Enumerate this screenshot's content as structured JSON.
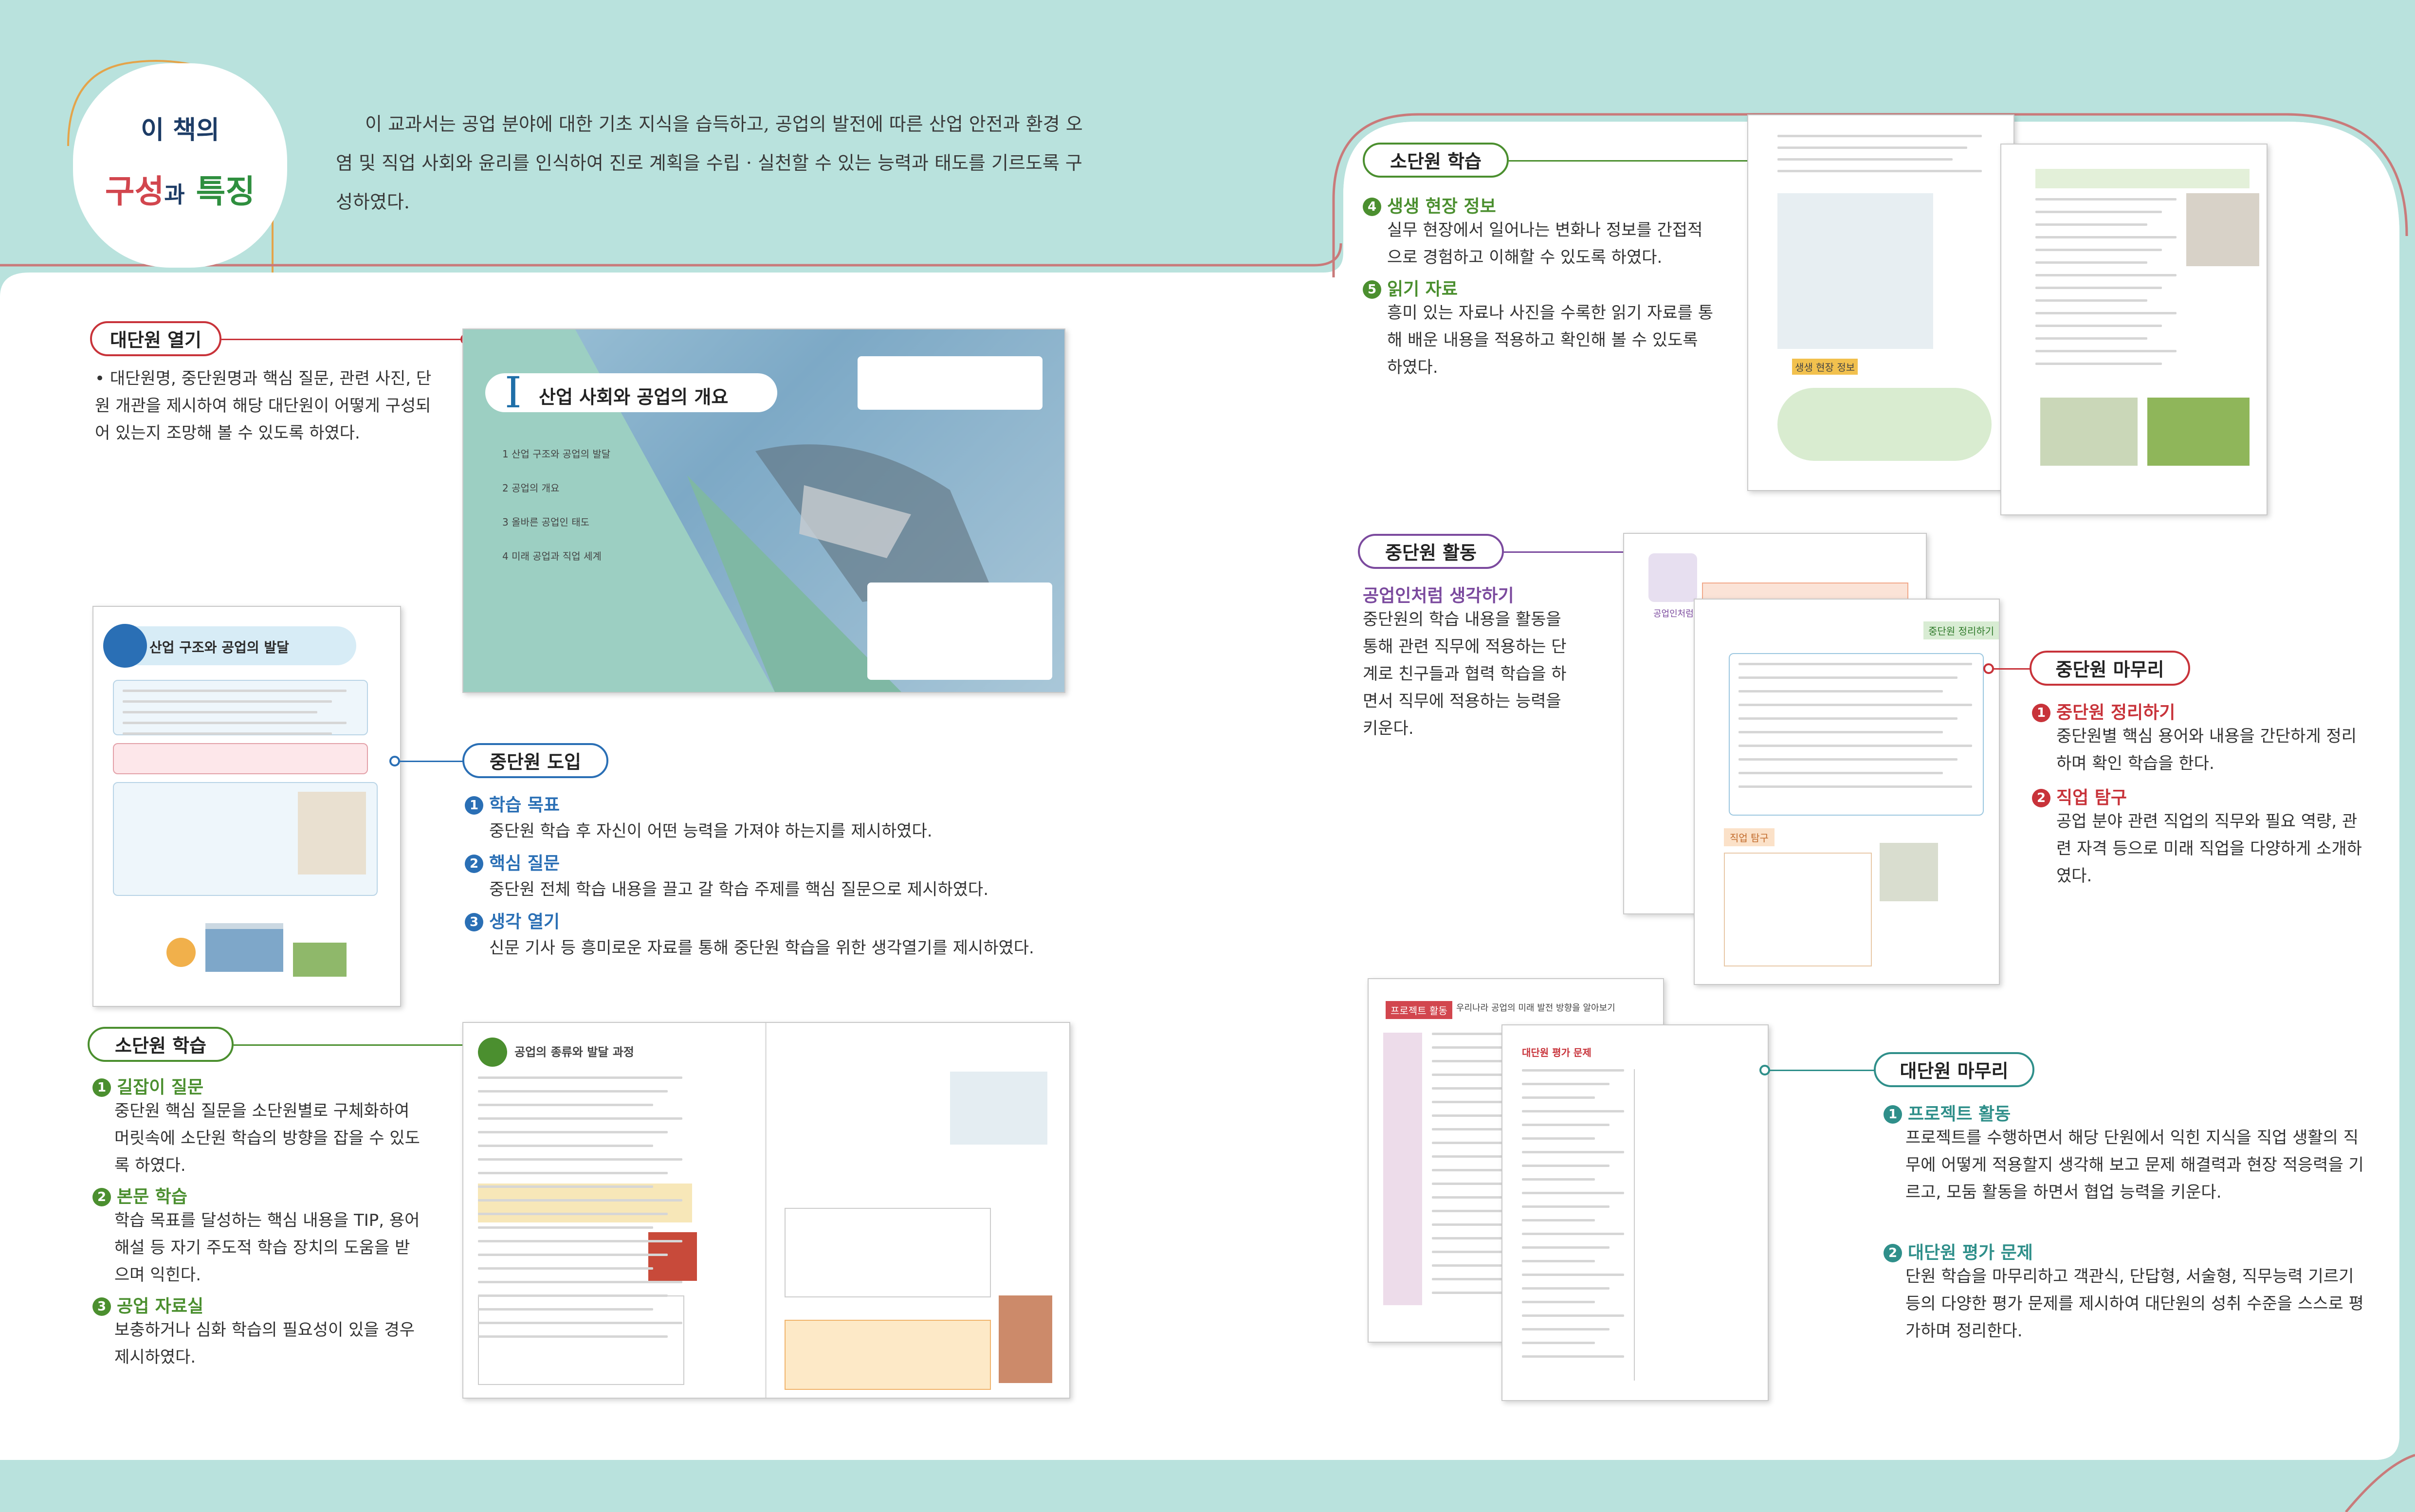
{
  "theme": {
    "mint": "#b9e2dd",
    "teal": "#1f8f84",
    "green": "#4b8f2f",
    "blue": "#2a6fb5",
    "purple": "#7b4a9e",
    "red": "#c8333a"
  },
  "badge": {
    "line1": "이 책의",
    "line2a": "구성",
    "line2b": "과",
    "line2c": "특징"
  },
  "intro_text": "이 교과서는 공업 분야에 대한 기초 지식을 습득하고, 공업의 발전에 따른 산업 안전과 환경 오염 및 직업 사회와 윤리를 인식하여 진로 계획을 수립 · 실천할 수 있는 능력과 태도를 기르도록 구성하였다.",
  "sections": {
    "dae_open": {
      "label": "대단원 열기",
      "text": "대단원명, 중단원명과 핵심 질문, 관련 사진, 단원 개관을 제시하여 해당 대단원이 어떻게 구성되어 있는지 조망해 볼 수 있도록 하였다."
    },
    "jung_intro": {
      "label": "중단원 도입",
      "items": [
        {
          "n": "1",
          "title": "학습 목표",
          "text": "중단원 학습 후 자신이 어떤 능력을 가져야 하는지를 제시하였다."
        },
        {
          "n": "2",
          "title": "핵심 질문",
          "text": "중단원 전체 학습 내용을 끌고 갈 학습 주제를 핵심 질문으로 제시하였다."
        },
        {
          "n": "3",
          "title": "생각 열기",
          "text": "신문 기사 등 흥미로운 자료를 통해 중단원 학습을 위한 생각열기를 제시하였다."
        }
      ]
    },
    "so_left": {
      "label": "소단원 학습",
      "items": [
        {
          "n": "1",
          "title": "길잡이 질문",
          "text": "중단원 핵심 질문을 소단원별로 구체화하여 머릿속에 소단원 학습의 방향을 잡을 수 있도록 하였다."
        },
        {
          "n": "2",
          "title": "본문 학습",
          "text": "학습 목표를 달성하는 핵심 내용을 TIP, 용어 해설 등 자기 주도적 학습 장치의 도움을 받으며 익힌다."
        },
        {
          "n": "3",
          "title": "공업 자료실",
          "text": "보충하거나 심화 학습의 필요성이 있을 경우 제시하였다."
        }
      ]
    },
    "so_right": {
      "label": "소단원 학습",
      "items": [
        {
          "n": "4",
          "title": "생생 현장 정보",
          "text": "실무 현장에서 일어나는 변화나 정보를 간접적으로 경험하고 이해할 수 있도록 하였다."
        },
        {
          "n": "5",
          "title": "읽기 자료",
          "text": "흥미 있는 자료나 사진을 수록한 읽기 자료를 통해 배운 내용을 적용하고 확인해 볼 수 있도록 하였다."
        }
      ]
    },
    "jung_activity": {
      "label": "중단원 활동",
      "title": "공업인처럼 생각하기",
      "text": "중단원의 학습 내용을 활동을 통해 관련 직무에 적용하는 단계로 친구들과 협력 학습을 하면서 직무에 적용하는 능력을 키운다."
    },
    "jung_finish": {
      "label": "중단원 마무리",
      "items": [
        {
          "n": "1",
          "title": "중단원 정리하기",
          "text": "중단원별 핵심 용어와 내용을 간단하게 정리하며 확인 학습을 한다."
        },
        {
          "n": "2",
          "title": "직업 탐구",
          "text": "공업 분야 관련 직업의 직무와 필요 역량, 관련 자격 등으로 미래 직업을 다양하게 소개하였다."
        }
      ]
    },
    "dae_finish": {
      "label": "대단원 마무리",
      "items": [
        {
          "n": "1",
          "title": "프로젝트 활동",
          "text": "프로젝트를 수행하면서 해당 단원에서 익힌 지식을 직업 생활의 직무에 어떻게 적용할지 생각해 보고 문제 해결력과 현장 적응력을 기르고, 모둠 활동을 하면서 협업 능력을 키운다."
        },
        {
          "n": "2",
          "title": "대단원 평가 문제",
          "text": "단원 학습을 마무리하고 객관식, 단답형, 서술형, 직무능력 기르기 등의 다양한 평가 문제를 제시하여 대단원의 성취 수준을 스스로 평가하며 정리한다."
        }
      ]
    }
  },
  "thumbs": {
    "unit_open_num": "I",
    "unit_open_title": "산업 사회와 공업의 개요",
    "unit_open_chapters": [
      "1 산업 구조와 공업의 발달",
      "2 공업의 개요",
      "3 올바른 공업인 태도",
      "4 미래 공업과 직업 세계"
    ],
    "intro_page_title": "산업 구조와 공업의 발달",
    "so_page_title": "공업의 종류와 발달 과정",
    "read_title": "생생 현장 정보",
    "activity_tag": "공업인처럼 생각하기",
    "finish_tag": "중단원 정리하기",
    "job_tag": "직업 탐구",
    "project_tag": "프로젝트 활동",
    "project_title": "우리나라 공업의 미래 발전 방향을 알아보기",
    "eval_tag": "대단원 평가 문제"
  }
}
